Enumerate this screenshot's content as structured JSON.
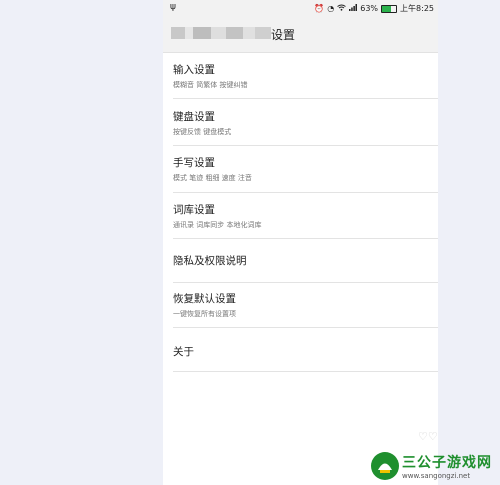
{
  "status": {
    "usb_icon": "usb-icon",
    "icons": [
      "alarm-icon",
      "clock-icon",
      "wifi-icon",
      "signal-icon"
    ],
    "battery_percent": "63%",
    "battery_level": 0.63,
    "time": "上午8:25"
  },
  "header": {
    "title": "设置"
  },
  "settings": [
    {
      "name": "输入设置",
      "desc": "模糊音 简繁体 按键纠错"
    },
    {
      "name": "键盘设置",
      "desc": "按键反馈 键盘模式"
    },
    {
      "name": "手写设置",
      "desc": "模式 笔迹 粗细 速度 注音"
    },
    {
      "name": "词库设置",
      "desc": "通讯录 词库同步 本地化词库"
    },
    {
      "name": "隐私及权限说明",
      "desc": ""
    },
    {
      "name": "恢复默认设置",
      "desc": "一键恢复所有设置项"
    },
    {
      "name": "关于",
      "desc": ""
    }
  ],
  "watermark": {
    "name": "三公子游戏网",
    "url": "www.sangongzi.net"
  }
}
